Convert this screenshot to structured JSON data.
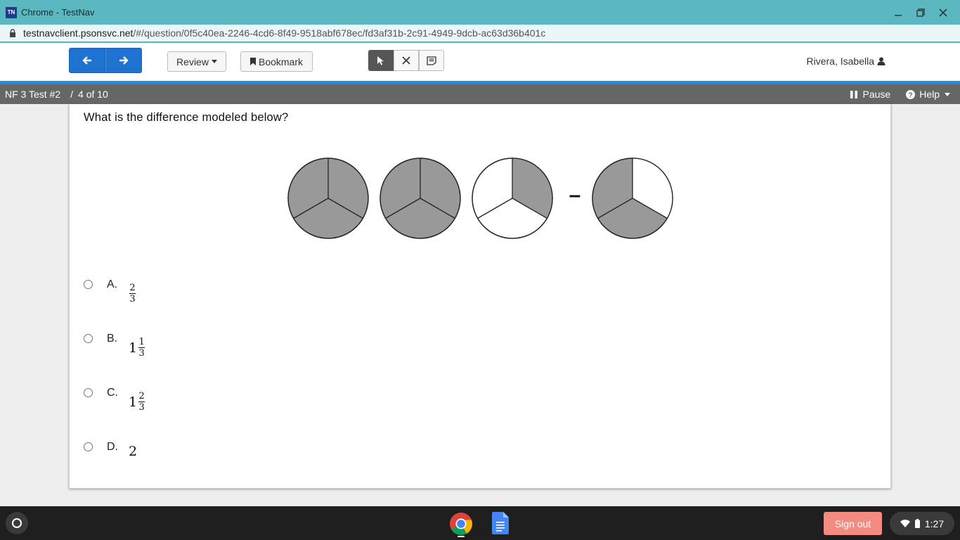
{
  "window": {
    "logo": "TN",
    "title": "Chrome - TestNav"
  },
  "url": {
    "host": "testnavclient.psonsvc.net",
    "path": "/#/question/0f5c40ea-2246-4cd6-8f49-9518abf678ec/fd3af31b-2c91-4949-9dcb-ac63d36b401c"
  },
  "toolbar": {
    "review_label": "Review",
    "bookmark_label": "Bookmark",
    "tools": [
      "pointer-icon",
      "eliminator-icon",
      "notepad-icon"
    ],
    "active_tool": "pointer-icon",
    "user_name": "Rivera, Isabella"
  },
  "infobar": {
    "test_name": "NF 3 Test #2",
    "separator": "/",
    "progress": "4 of 10",
    "pause_label": "Pause",
    "help_label": "Help"
  },
  "question": {
    "prompt": "What is the difference modeled below?",
    "model": {
      "circles_before_minus": [
        {
          "shaded_thirds": 3
        },
        {
          "shaded_thirds": 3
        },
        {
          "shaded_thirds": 1
        }
      ],
      "operator": "–",
      "circles_after_minus": [
        {
          "shaded_thirds": 2
        }
      ],
      "shade_color": "#999999"
    },
    "choices": [
      {
        "letter": "A.",
        "whole": "",
        "numerator": "2",
        "denominator": "3"
      },
      {
        "letter": "B.",
        "whole": "1",
        "numerator": "1",
        "denominator": "3"
      },
      {
        "letter": "C.",
        "whole": "1",
        "numerator": "2",
        "denominator": "3"
      },
      {
        "letter": "D.",
        "whole": "2",
        "numerator": "",
        "denominator": ""
      }
    ]
  },
  "taskbar": {
    "signout_label": "Sign out",
    "time": "1:27"
  },
  "colors": {
    "titlebar": "#5cb8c0",
    "nav_button": "#1f73d0",
    "accent_stripe": "#1f8fd4",
    "infobar": "#666666",
    "signout": "#f28b82"
  }
}
